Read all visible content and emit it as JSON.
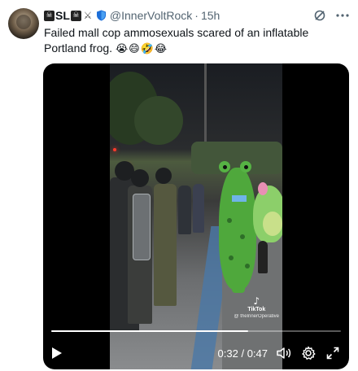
{
  "author": {
    "display_name": "SL",
    "emoji_before": "☠",
    "emoji_after": "☠",
    "handle": "@InnerVoltRock",
    "separator": "·",
    "time": "15h"
  },
  "tweet": {
    "text": "Failed mall cop ammosexuals scared of an inflatable Portland frog.",
    "emojis": "😭😄🤣😂"
  },
  "video": {
    "watermark_brand": "TikTok",
    "watermark_user": "@ thelnnerOperative",
    "current_time": "0:32",
    "total_time": "0:47",
    "time_separator": " / ",
    "progress": 0.68
  },
  "icons": {
    "grok": "grok-icon",
    "more": "more-icon",
    "play": "play-icon",
    "volume": "volume-icon",
    "settings": "settings-icon",
    "fullscreen": "fullscreen-icon",
    "verified_shield": "shield-icon",
    "swords": "crossed-swords-icon"
  },
  "colors": {
    "text_primary": "#0f1419",
    "text_secondary": "#536471",
    "video_bg": "#000000"
  }
}
